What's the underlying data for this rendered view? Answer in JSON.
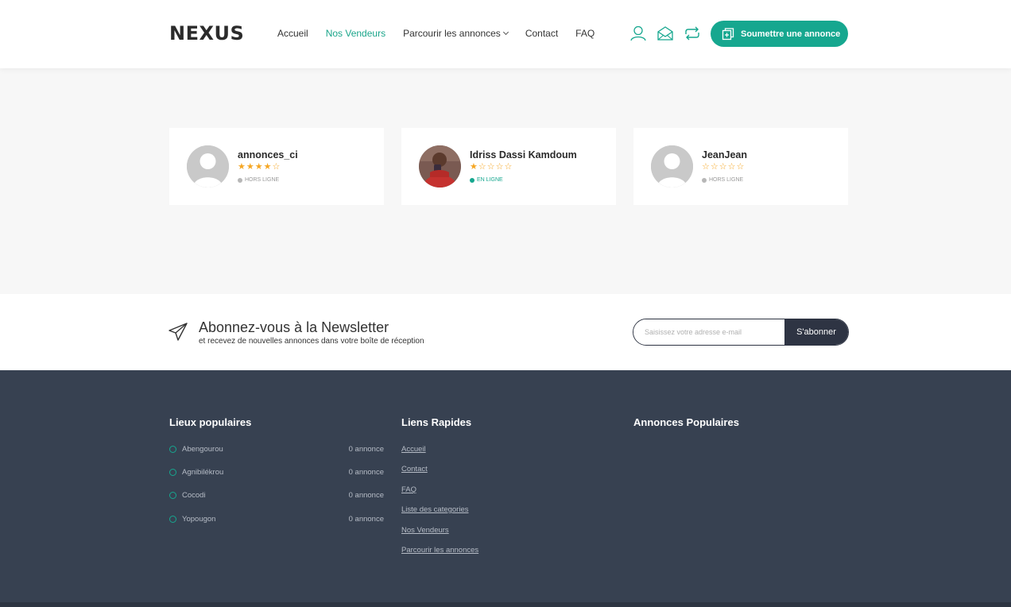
{
  "header": {
    "logo": "NEXUS",
    "nav": [
      {
        "label": "Accueil",
        "active": false
      },
      {
        "label": "Nos Vendeurs",
        "active": true
      },
      {
        "label": "Parcourir les annonces",
        "active": false,
        "dropdown": true
      },
      {
        "label": "Contact",
        "active": false
      },
      {
        "label": "FAQ",
        "active": false
      }
    ],
    "icons": [
      "user-icon",
      "mail-icon",
      "exchange-icon"
    ],
    "submit_label": "Soumettre une annonce"
  },
  "vendors": [
    {
      "name": "annonces_ci",
      "rating": 4,
      "max_rating": 5,
      "status": "HORS LIGNE",
      "online": false,
      "avatar": "default"
    },
    {
      "name": "Idriss Dassi Kamdoum",
      "rating": 1,
      "max_rating": 5,
      "status": "EN LIGNE",
      "online": true,
      "avatar": "photo"
    },
    {
      "name": "JeanJean",
      "rating": 0,
      "max_rating": 5,
      "status": "HORS LIGNE",
      "online": false,
      "avatar": "default"
    }
  ],
  "newsletter": {
    "title": "Abonnez-vous à la Newsletter",
    "subtitle": "et recevez de nouvelles annonces dans votre boîte de réception",
    "placeholder": "Saisissez votre adresse e-mail",
    "button": "S'abonner"
  },
  "footer": {
    "popular_places": {
      "title": "Lieux populaires",
      "items": [
        {
          "name": "Abengourou",
          "count": "0 annonce"
        },
        {
          "name": "Agnibilékrou",
          "count": "0 annonce"
        },
        {
          "name": "Cocodi",
          "count": "0 annonce"
        },
        {
          "name": "Yopougon",
          "count": "0 annonce"
        }
      ]
    },
    "quick_links": {
      "title": "Liens Rapides",
      "items": [
        "Accueil",
        "Contact",
        "FAQ",
        "Liste des categories",
        "Nos Vendeurs",
        "Parcourir les annonces"
      ]
    },
    "popular_ads": {
      "title": "Annonces Populaires"
    }
  },
  "colors": {
    "accent": "#16a78f",
    "footer_bg": "#374151",
    "dark_button": "#2e3443",
    "star": "#f5a623"
  }
}
